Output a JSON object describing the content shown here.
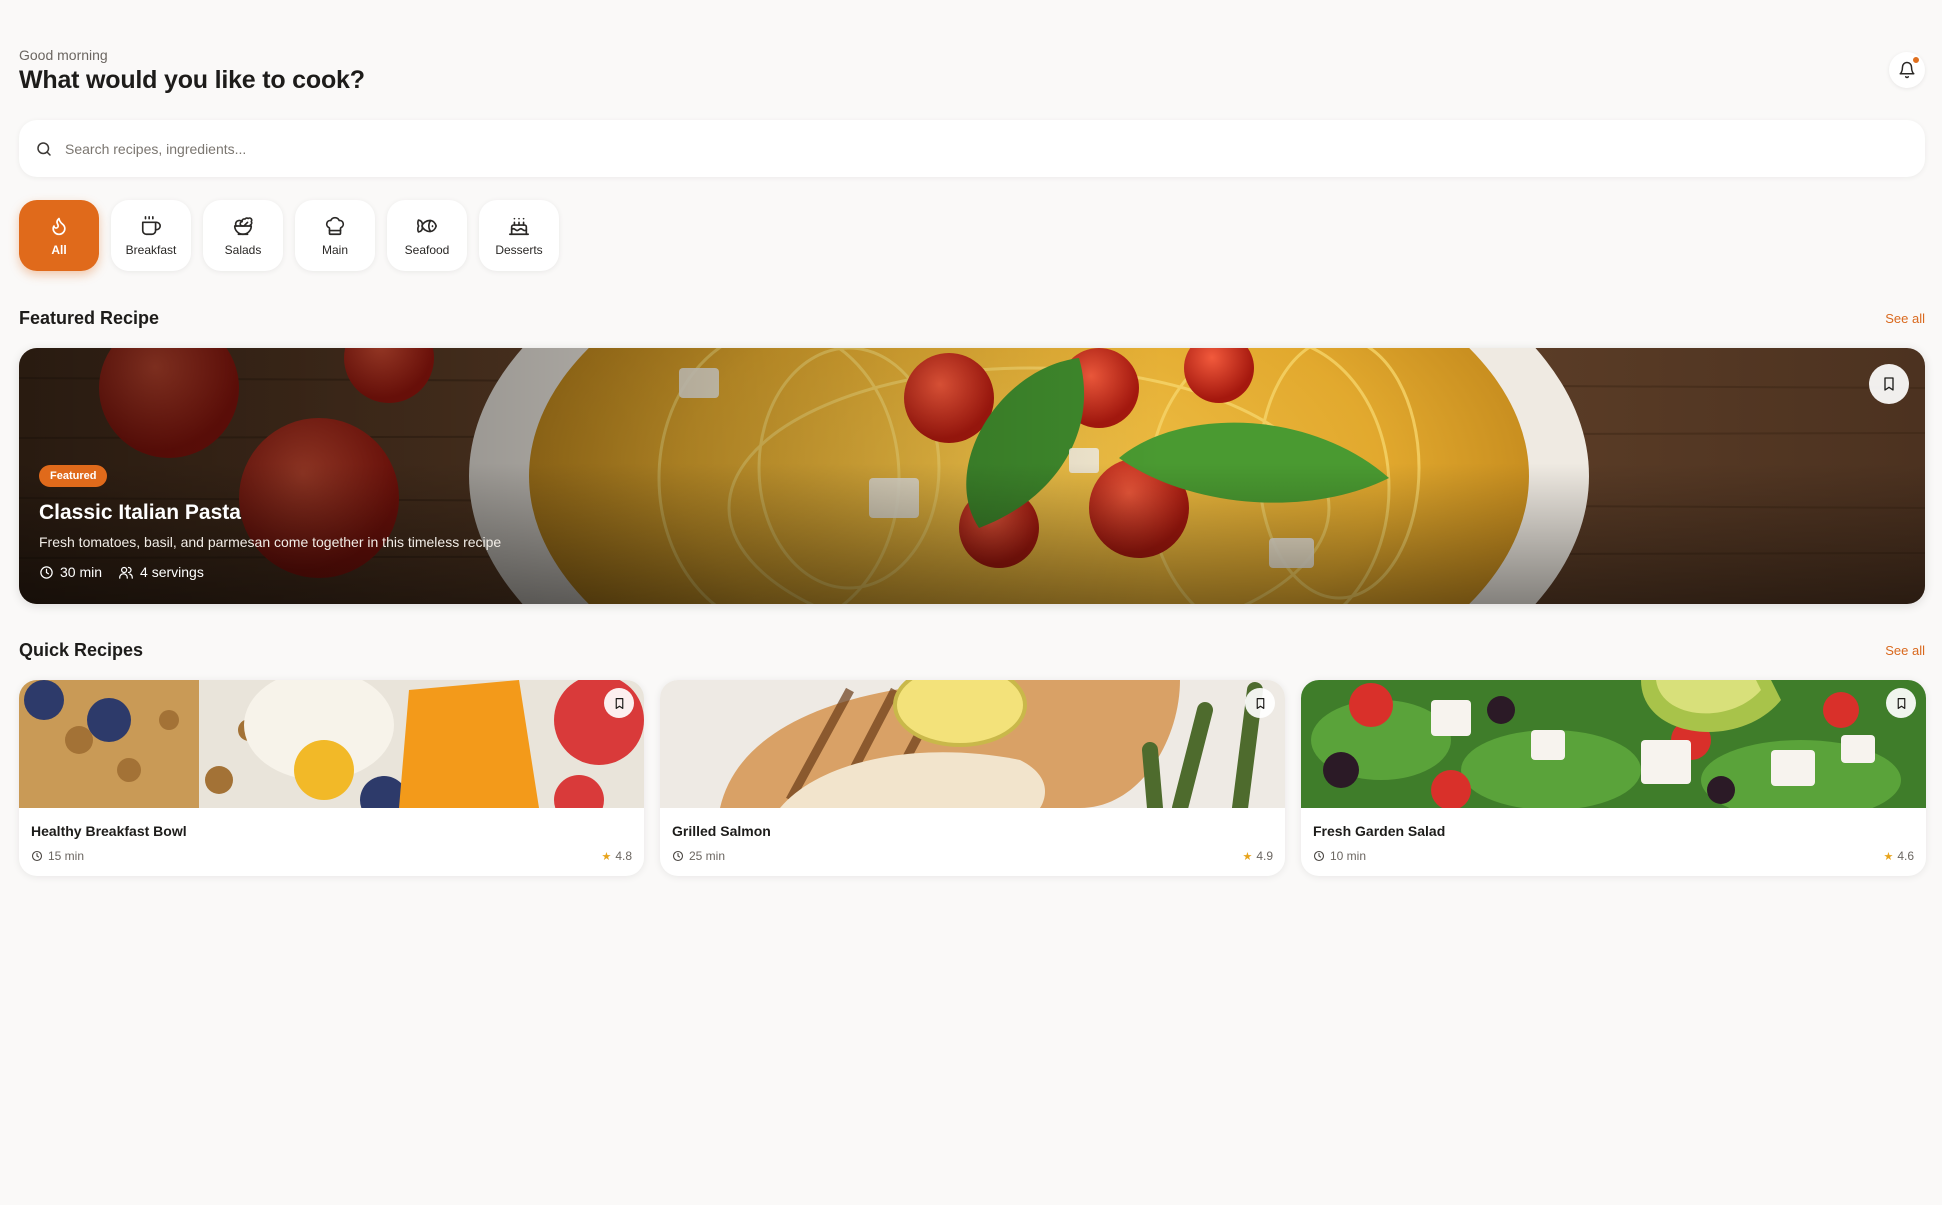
{
  "header": {
    "greeting": "Good morning",
    "title": "What would you like to cook?",
    "notification_icon": "bell-icon"
  },
  "search": {
    "placeholder": "Search recipes, ingredients...",
    "icon": "search-icon"
  },
  "categories": [
    {
      "label": "All",
      "icon": "flame-icon",
      "active": true
    },
    {
      "label": "Breakfast",
      "icon": "coffee-icon",
      "active": false
    },
    {
      "label": "Salads",
      "icon": "salad-icon",
      "active": false
    },
    {
      "label": "Main",
      "icon": "chef-hat-icon",
      "active": false
    },
    {
      "label": "Seafood",
      "icon": "fish-icon",
      "active": false
    },
    {
      "label": "Desserts",
      "icon": "cake-icon",
      "active": false
    }
  ],
  "featured_section": {
    "title": "Featured Recipe",
    "see_all": "See all",
    "recipe": {
      "badge": "Featured",
      "title": "Classic Italian Pasta",
      "description": "Fresh tomatoes, basil, and parmesan come together in this timeless recipe",
      "time": "30 min",
      "servings": "4 servings"
    }
  },
  "quick_section": {
    "title": "Quick Recipes",
    "see_all": "See all",
    "recipes": [
      {
        "title": "Healthy Breakfast Bowl",
        "time": "15 min",
        "rating": "4.8"
      },
      {
        "title": "Grilled Salmon",
        "time": "25 min",
        "rating": "4.9"
      },
      {
        "title": "Fresh Garden Salad",
        "time": "10 min",
        "rating": "4.6"
      }
    ]
  },
  "colors": {
    "accent": "#e06a1b",
    "background": "#faf9f8",
    "star": "#e8a41c"
  }
}
